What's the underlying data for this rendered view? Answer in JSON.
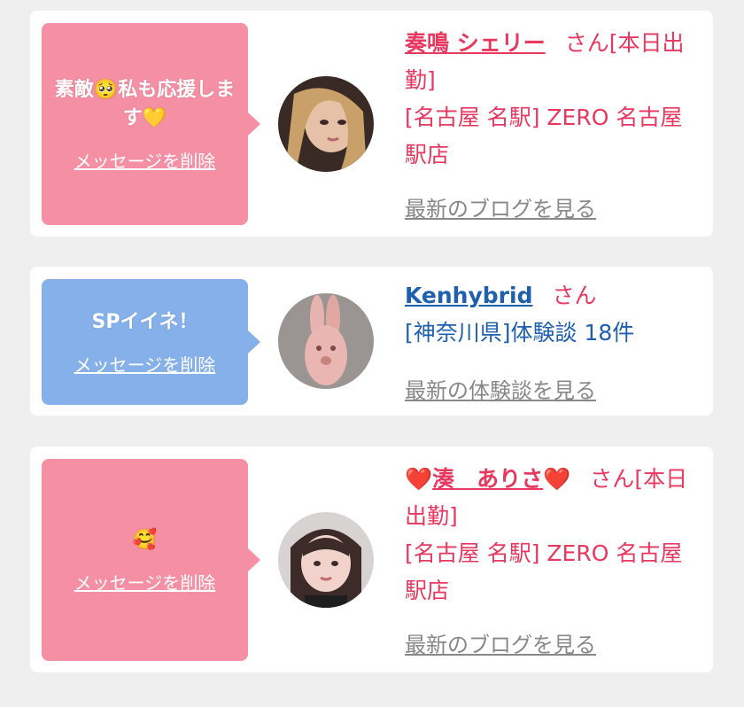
{
  "colors": {
    "pink_bubble": "#f48fa4",
    "blue_bubble": "#85b0ea",
    "pink_text": "#e8385f",
    "blue_text": "#1f5fb0",
    "gray_link": "#888888"
  },
  "cards": [
    {
      "message": "素敵🥺私も応援します💛",
      "delete_label": "メッセージを削除",
      "name": "奏鳴 シェリー",
      "honorific": "さん",
      "status": "[本日出勤]",
      "shop": "[名古屋 名駅] ZERO 名古屋駅店",
      "link_label": "最新のブログを見る"
    },
    {
      "message": "SPイイネ！",
      "delete_label": "メッセージを削除",
      "name": "Kenhybrid",
      "honorific": "さん",
      "detail": "[神奈川県]体験談 18件",
      "link_label": "最新の体験談を見る"
    },
    {
      "message": "🥰",
      "delete_label": "メッセージを削除",
      "name_heart_left": "❤️",
      "name": "湊　ありさ",
      "name_heart_right": "❤️",
      "honorific": "さん",
      "status": "[本日出勤]",
      "shop": "[名古屋 名駅] ZERO 名古屋駅店",
      "link_label": "最新のブログを見る"
    }
  ]
}
